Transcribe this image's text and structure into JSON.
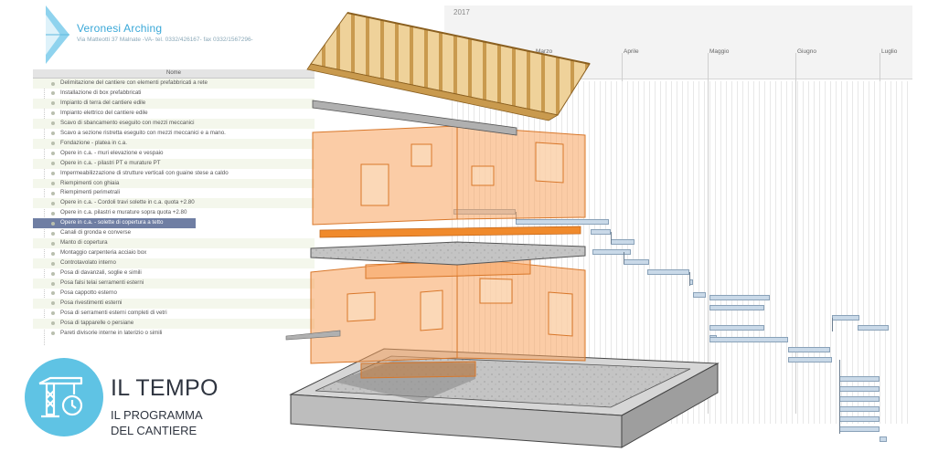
{
  "company": {
    "name": "Veronesi Arching",
    "address": "Via Matteotti 37 Malnate -VA- tel. 0332/426167- fax 0332/1567296-"
  },
  "task_list": {
    "column_header": "Nome",
    "selected_index": 15,
    "tasks": [
      "Delimitazione del cantiere con elementi prefabbricati a rete",
      "Installazione di box prefabbricati",
      "Impianto di terra del cantiere edile",
      "Impianto elettrico del cantiere edile",
      "Scavo di sbancamento eseguito con mezzi meccanici",
      "Scavo a sezione ristretta eseguito con mezzi meccanici e a mano.",
      "Fondazione - platea in c.a.",
      "Opere in c.a. - muri elevazione e vespaio",
      "Opere in c.a. - pilastri PT e murature PT",
      "Impermeabilizzazione di strutture verticali con guaine stese a caldo",
      "Riempimenti con ghiaia",
      "Riempimenti perimetrali",
      "Opere in c.a. - Cordoli travi solette in c.a. quota +2.80",
      "Opere in c.a. pilastri e murature sopra quota +2.80",
      "Opere in c.a. - solette di copertura a tetto",
      "Canali di gronda e converse",
      "Manto di copertura",
      "Montaggio carpenteria acciaio box",
      "Controtavolato interno",
      "Posa di davanzali, soglie e simili",
      "Posa falsi telai serramenti esterni",
      "Posa cappotto esterno",
      "Posa rivestimenti esterni",
      "Posa di serramenti esterni completi di vetri",
      "Posa di tapparelle o persiane",
      "Pareti divisorie interne in laterizio o simili"
    ]
  },
  "gantt": {
    "year": "2017",
    "months": [
      "Marzo",
      "Aprile",
      "Maggio",
      "Giugno",
      "Luglio"
    ]
  },
  "badge": {
    "icon": "crane-clock-icon",
    "title": "IL TEMPO",
    "subtitle_line1": "IL PROGRAMMA",
    "subtitle_line2": "DEL CANTIERE"
  },
  "colors": {
    "accent_blue": "#5fc3e4",
    "selected_row": "#6f7ea3",
    "gantt_bar": "#c9d9e8",
    "wall_orange": "#f7a35c",
    "roof_wood": "#e9c27a",
    "concrete": "#b8b8b8"
  }
}
